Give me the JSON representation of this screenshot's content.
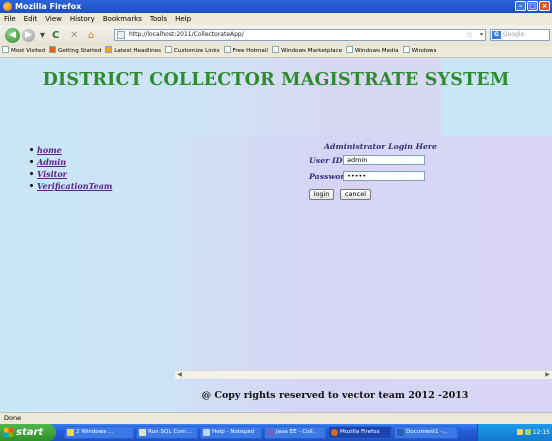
{
  "window": {
    "title": "Mozilla Firefox"
  },
  "menubar": {
    "items": [
      "File",
      "Edit",
      "View",
      "History",
      "Bookmarks",
      "Tools",
      "Help"
    ]
  },
  "navbar": {
    "url": "http://localhost:2011/CollectorateApp/",
    "search_placeholder": "Google"
  },
  "bookmarks": {
    "items": [
      "Most Visited",
      "Getting Started",
      "Latest Headlines",
      "Customize Links",
      "Free Hotmail",
      "Windows Marketplace",
      "Windows Media",
      "Windows"
    ]
  },
  "page": {
    "heading": "DISTRICT COLLECTOR MAGISTRATE SYSTEM",
    "nav_links": [
      "home",
      "Admin",
      "Visitor",
      "VerificationTeam"
    ],
    "login": {
      "title": "Administrator Login Here",
      "userid_label": "User ID",
      "userid_value": "admin",
      "password_label": "Password",
      "password_value": "•••••",
      "login_button": "login",
      "cancel_button": "cancel"
    },
    "footer": "@ Copy rights reserved to vector team 2012 -2013"
  },
  "statusbar": {
    "text": "Done"
  },
  "taskbar": {
    "start_label": "start",
    "tasks": [
      "2 Windows ...",
      "Run SQL Com...",
      "Help - Notepad",
      "Java EE - Coll...",
      "Mozilla Firefox",
      "Document1 -..."
    ],
    "clock": "12:15"
  }
}
